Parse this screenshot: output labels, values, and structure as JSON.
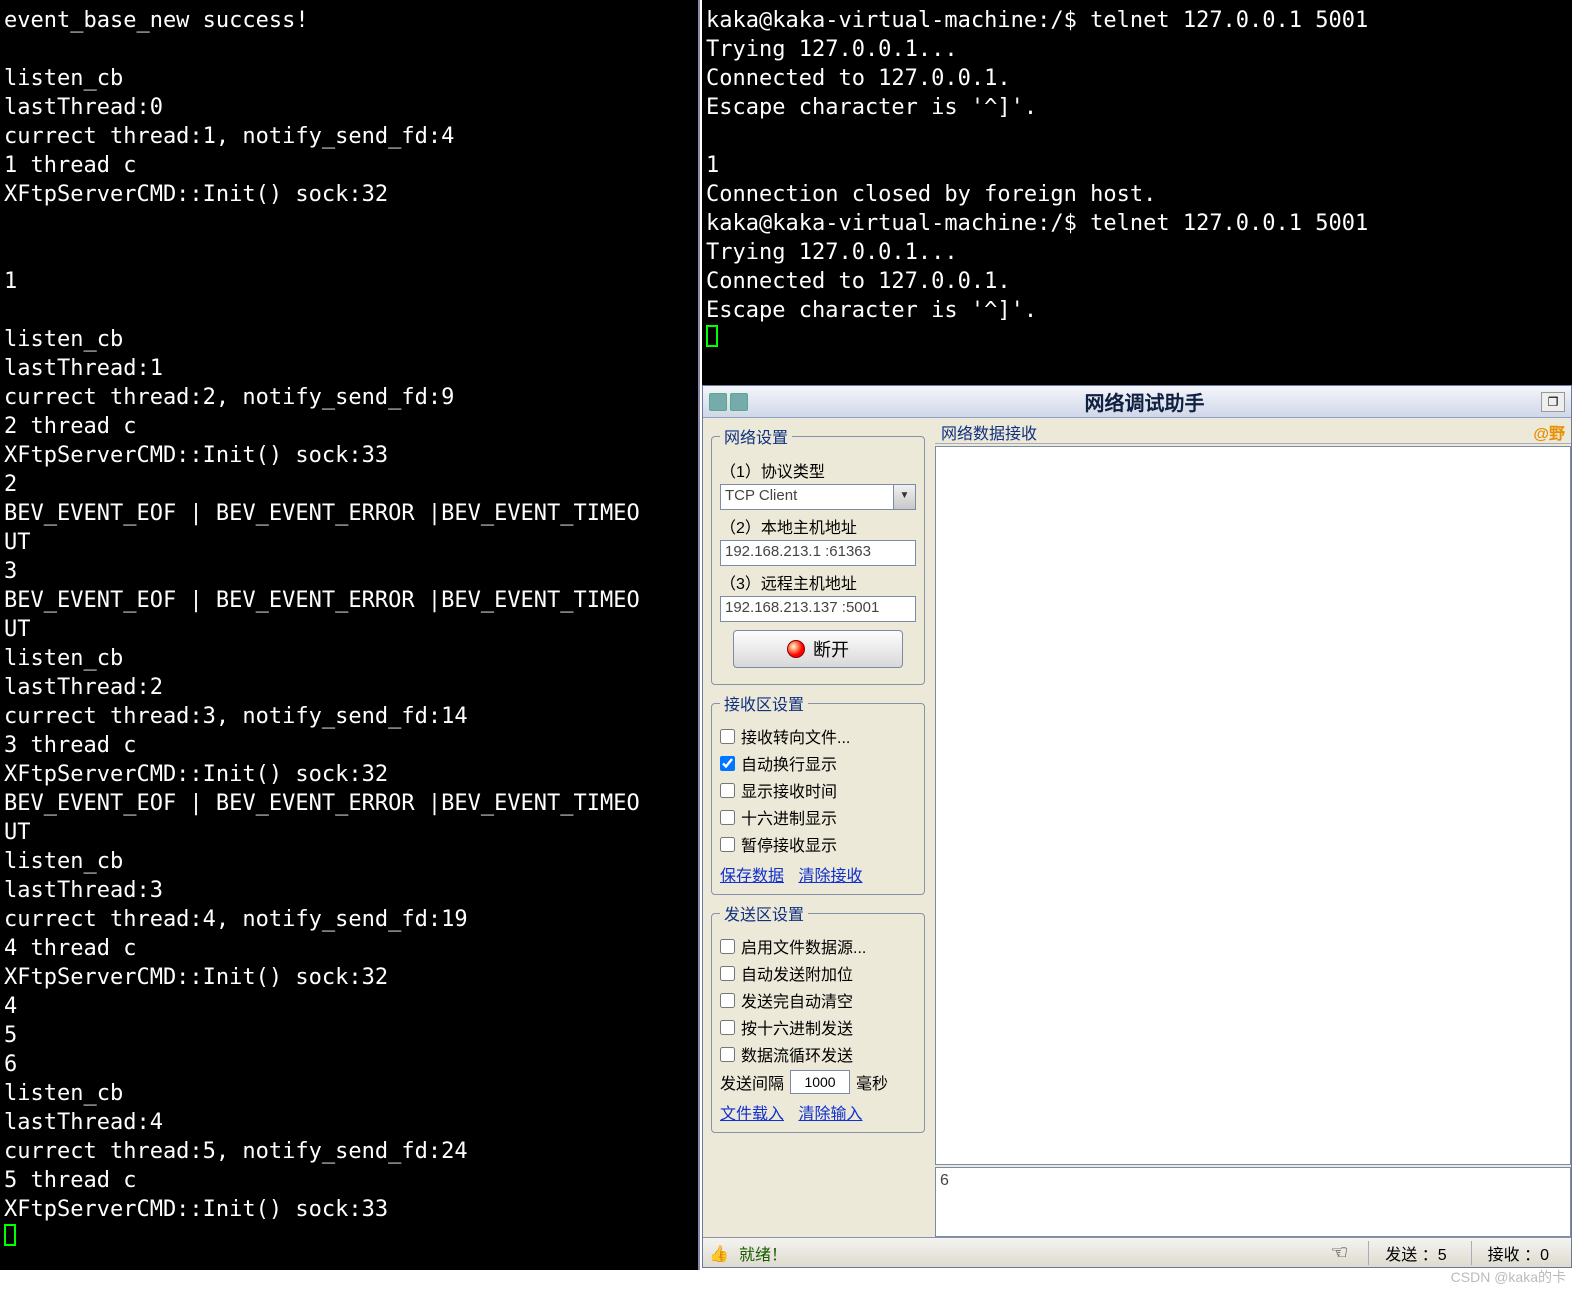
{
  "left_terminal_text": "event_base_new success!\n\nlisten_cb\nlastThread:0\ncurrect thread:1, notify_send_fd:4\n1 thread c\nXFtpServerCMD::Init() sock:32\n\n\n1\n\nlisten_cb\nlastThread:1\ncurrect thread:2, notify_send_fd:9\n2 thread c\nXFtpServerCMD::Init() sock:33\n2\nBEV_EVENT_EOF | BEV_EVENT_ERROR |BEV_EVENT_TIMEO\nUT\n3\nBEV_EVENT_EOF | BEV_EVENT_ERROR |BEV_EVENT_TIMEO\nUT\nlisten_cb\nlastThread:2\ncurrect thread:3, notify_send_fd:14\n3 thread c\nXFtpServerCMD::Init() sock:32\nBEV_EVENT_EOF | BEV_EVENT_ERROR |BEV_EVENT_TIMEO\nUT\nlisten_cb\nlastThread:3\ncurrect thread:4, notify_send_fd:19\n4 thread c\nXFtpServerCMD::Init() sock:32\n4\n5\n6\nlisten_cb\nlastThread:4\ncurrect thread:5, notify_send_fd:24\n5 thread c\nXFtpServerCMD::Init() sock:33",
  "right_terminal_text": "kaka@kaka-virtual-machine:/$ telnet 127.0.0.1 5001\nTrying 127.0.0.1...\nConnected to 127.0.0.1.\nEscape character is '^]'.\n\n1\nConnection closed by foreign host.\nkaka@kaka-virtual-machine:/$ telnet 127.0.0.1 5001\nTrying 127.0.0.1...\nConnected to 127.0.0.1.\nEscape character is '^]'.",
  "net_window": {
    "title": "网络调试助手",
    "brand": "@野",
    "groups": {
      "net_settings": {
        "legend": "网络设置",
        "proto_label": "（1）协议类型",
        "proto_value": "TCP Client",
        "local_label": "（2）本地主机地址",
        "local_value": "192.168.213.1 :61363",
        "remote_label": "（3）远程主机地址",
        "remote_value": "192.168.213.137 :5001",
        "disconnect_label": "断开"
      },
      "recv_settings": {
        "legend": "接收区设置",
        "opts": [
          {
            "label": "接收转向文件...",
            "checked": false
          },
          {
            "label": "自动换行显示",
            "checked": true
          },
          {
            "label": "显示接收时间",
            "checked": false
          },
          {
            "label": "十六进制显示",
            "checked": false
          },
          {
            "label": "暂停接收显示",
            "checked": false
          }
        ],
        "links": {
          "save": "保存数据",
          "clear": "清除接收"
        }
      },
      "send_settings": {
        "legend": "发送区设置",
        "opts": [
          {
            "label": "启用文件数据源...",
            "checked": false
          },
          {
            "label": "自动发送附加位",
            "checked": false
          },
          {
            "label": "发送完自动清空",
            "checked": false
          },
          {
            "label": "按十六进制发送",
            "checked": false
          },
          {
            "label": "数据流循环发送",
            "checked": false
          }
        ],
        "interval_label": "发送间隔",
        "interval_value": "1000",
        "interval_unit": "毫秒",
        "links": {
          "load": "文件载入",
          "clear": "清除输入"
        }
      }
    },
    "recv_header": "网络数据接收",
    "send_value": "6",
    "status": {
      "ready": "就绪！",
      "sent_label": "发送 ：5",
      "recv_label": "接收 ：0"
    }
  },
  "watermark": "CSDN @kaka的卡"
}
